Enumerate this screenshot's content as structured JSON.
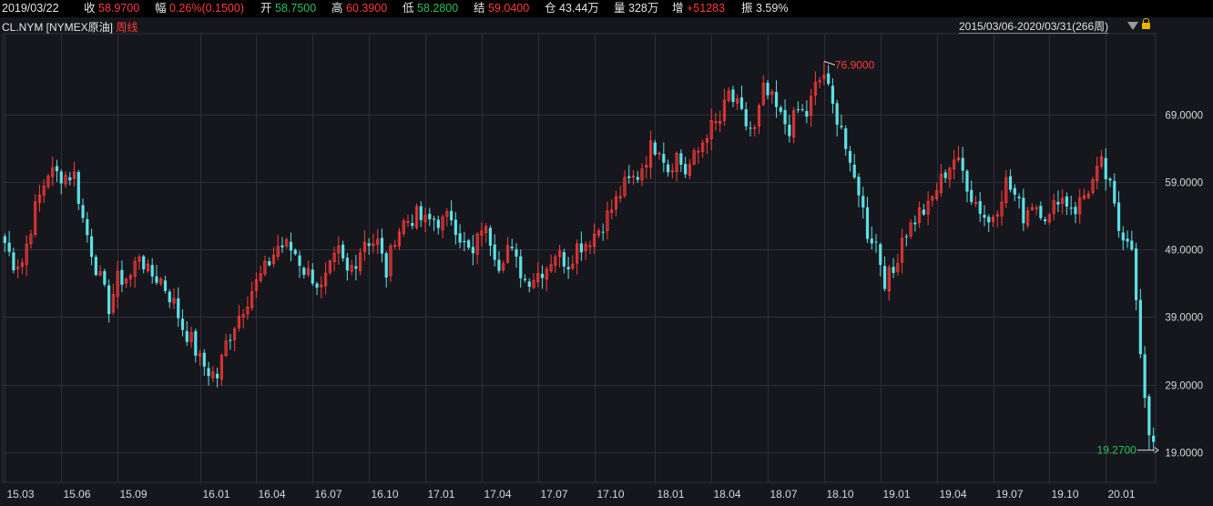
{
  "info": {
    "date": "2019/03/22",
    "close_label": "收",
    "close_value": "58.9700",
    "change_label": "幅",
    "change_value": "0.26%(0.1500)",
    "open_label": "开",
    "open_value": "58.7500",
    "high_label": "高",
    "high_value": "60.3900",
    "low_label": "低",
    "low_value": "58.2800",
    "settle_label": "结",
    "settle_value": "59.0400",
    "oi_label": "仓",
    "oi_value": "43.44万",
    "volume_label": "量",
    "volume_value": "328万",
    "increase_label": "增",
    "increase_value": "+51283",
    "amplitude_label": "振",
    "amplitude_value": "3.59%"
  },
  "subtitle": {
    "symbol": "CL.NYM [NYMEX原油]",
    "period": "周线"
  },
  "range": {
    "label": "2015/03/06-2020/03/31(266周)"
  },
  "colors": {
    "up": "#ff3b3b",
    "down": "#5ce0e6",
    "grid": "#2e3037",
    "background": "#16171c",
    "annotation_high": "#ff3b3b",
    "annotation_low": "#22c35e"
  },
  "icons": {
    "range_dropdown": "triangle-down-icon",
    "lock": "lock-icon"
  },
  "chart_data": {
    "type": "candlestick",
    "period": "weekly",
    "ylim": [
      14.5,
      81.0
    ],
    "y_ticks": [
      "19.0000",
      "29.0000",
      "39.0000",
      "49.0000",
      "59.0000",
      "69.0000"
    ],
    "y_tick_values": [
      19,
      29,
      39,
      49,
      59,
      69
    ],
    "x_ticks": [
      "15.03",
      "15.06",
      "15.09",
      "16.01",
      "16.04",
      "16.07",
      "16.10",
      "17.01",
      "17.04",
      "17.07",
      "17.10",
      "18.01",
      "18.04",
      "18.07",
      "18.10",
      "19.01",
      "19.04",
      "19.07",
      "19.10",
      "20.01"
    ],
    "x_tick_index": [
      0,
      13,
      26,
      45,
      58,
      71,
      84,
      97,
      110,
      123,
      136,
      150,
      163,
      176,
      189,
      202,
      215,
      228,
      241,
      254
    ],
    "total_bars": 266,
    "high_annotation": {
      "text": "76.9000",
      "value": 76.9,
      "index": 189
    },
    "low_annotation": {
      "text": "19.2700",
      "value": 19.27,
      "index": 264
    },
    "series": [
      {
        "name": "",
        "anchors": [
          [
            0,
            50.0
          ],
          [
            2,
            47.0
          ],
          [
            4,
            47.2
          ],
          [
            7,
            55.0
          ],
          [
            10,
            60.5
          ],
          [
            13,
            60.0
          ],
          [
            16,
            60.0
          ],
          [
            18,
            53.5
          ],
          [
            21,
            46.5
          ],
          [
            24,
            40.5
          ],
          [
            26,
            44.5
          ],
          [
            29,
            45.0
          ],
          [
            31,
            48.5
          ],
          [
            33,
            45.5
          ],
          [
            36,
            44.5
          ],
          [
            39,
            41.0
          ],
          [
            41,
            37.5
          ],
          [
            43,
            35.5
          ],
          [
            45,
            32.5
          ],
          [
            47,
            31.0
          ],
          [
            49,
            30.2
          ],
          [
            51,
            35.0
          ],
          [
            53,
            38.0
          ],
          [
            55,
            40.5
          ],
          [
            57,
            43.0
          ],
          [
            60,
            46.0
          ],
          [
            63,
            49.5
          ],
          [
            65,
            49.5
          ],
          [
            67,
            48.5
          ],
          [
            69,
            46.0
          ],
          [
            71,
            45.0
          ],
          [
            73,
            43.0
          ],
          [
            75,
            46.0
          ],
          [
            77,
            48.5
          ],
          [
            79,
            45.5
          ],
          [
            81,
            47.5
          ],
          [
            83,
            50.5
          ],
          [
            86,
            50.0
          ],
          [
            88,
            45.5
          ],
          [
            90,
            51.0
          ],
          [
            92,
            53.0
          ],
          [
            95,
            54.0
          ],
          [
            97,
            53.0
          ],
          [
            99,
            53.5
          ],
          [
            101,
            53.0
          ],
          [
            103,
            54.0
          ],
          [
            106,
            49.5
          ],
          [
            108,
            48.0
          ],
          [
            110,
            52.5
          ],
          [
            112,
            50.5
          ],
          [
            114,
            47.0
          ],
          [
            116,
            49.5
          ],
          [
            118,
            47.0
          ],
          [
            120,
            44.5
          ],
          [
            122,
            45.0
          ],
          [
            125,
            46.5
          ],
          [
            127,
            48.5
          ],
          [
            130,
            47.0
          ],
          [
            132,
            49.5
          ],
          [
            134,
            50.0
          ],
          [
            137,
            52.0
          ],
          [
            140,
            55.0
          ],
          [
            143,
            58.5
          ],
          [
            146,
            60.0
          ],
          [
            149,
            64.0
          ],
          [
            151,
            64.5
          ],
          [
            153,
            61.0
          ],
          [
            155,
            63.0
          ],
          [
            157,
            60.5
          ],
          [
            160,
            63.5
          ],
          [
            162,
            66.5
          ],
          [
            165,
            68.0
          ],
          [
            167,
            72.0
          ],
          [
            169,
            70.0
          ],
          [
            171,
            67.5
          ],
          [
            173,
            66.5
          ],
          [
            175,
            72.5
          ],
          [
            177,
            71.0
          ],
          [
            179,
            68.5
          ],
          [
            181,
            67.0
          ],
          [
            183,
            69.5
          ],
          [
            185,
            69.0
          ],
          [
            187,
            73.0
          ],
          [
            189,
            75.0
          ],
          [
            191,
            70.0
          ],
          [
            193,
            67.5
          ],
          [
            195,
            60.5
          ],
          [
            197,
            58.0
          ],
          [
            199,
            51.5
          ],
          [
            201,
            50.0
          ],
          [
            203,
            44.5
          ],
          [
            205,
            45.5
          ],
          [
            207,
            51.0
          ],
          [
            209,
            52.5
          ],
          [
            211,
            54.5
          ],
          [
            213,
            55.0
          ],
          [
            215,
            58.0
          ],
          [
            217,
            60.5
          ],
          [
            219,
            62.5
          ],
          [
            221,
            60.5
          ],
          [
            223,
            57.0
          ],
          [
            225,
            55.0
          ],
          [
            227,
            53.0
          ],
          [
            229,
            55.5
          ],
          [
            231,
            59.0
          ],
          [
            233,
            57.0
          ],
          [
            235,
            54.0
          ],
          [
            237,
            56.0
          ],
          [
            239,
            55.0
          ],
          [
            241,
            53.5
          ],
          [
            243,
            57.0
          ],
          [
            245,
            56.0
          ],
          [
            247,
            55.0
          ],
          [
            249,
            57.0
          ],
          [
            251,
            59.0
          ],
          [
            253,
            61.5
          ],
          [
            255,
            58.0
          ],
          [
            257,
            52.0
          ],
          [
            259,
            51.0
          ],
          [
            260,
            49.0
          ],
          [
            261,
            41.5
          ],
          [
            262,
            33.5
          ],
          [
            263,
            27.0
          ],
          [
            264,
            21.5
          ],
          [
            265,
            20.5
          ]
        ]
      }
    ]
  }
}
